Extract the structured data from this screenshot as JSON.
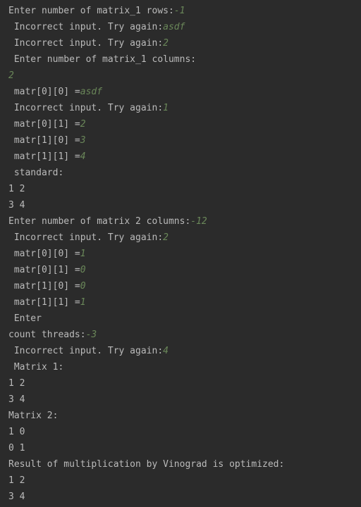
{
  "colors": {
    "background": "#2b2b2b",
    "output_text": "#bbbbbb",
    "user_input": "#6a8759"
  },
  "lines": [
    {
      "prompt": "Enter number of matrix_1 rows:",
      "input": "-1"
    },
    {
      "prompt": " Incorrect input. Try again:",
      "input": "asdf"
    },
    {
      "prompt": " Incorrect input. Try again:",
      "input": "2"
    },
    {
      "prompt": " Enter number of matrix_1 columns:",
      "input": ""
    },
    {
      "prompt": "",
      "input": "2"
    },
    {
      "prompt": " matr[0][0] =",
      "input": "asdf"
    },
    {
      "prompt": " Incorrect input. Try again:",
      "input": "1"
    },
    {
      "prompt": " matr[0][1] =",
      "input": "2"
    },
    {
      "prompt": " matr[1][0] =",
      "input": "3"
    },
    {
      "prompt": " matr[1][1] =",
      "input": "4"
    },
    {
      "prompt": " standard:",
      "input": ""
    },
    {
      "prompt": "1 2",
      "input": ""
    },
    {
      "prompt": "3 4",
      "input": ""
    },
    {
      "prompt": "Enter number of matrix 2 columns:",
      "input": "-12"
    },
    {
      "prompt": " Incorrect input. Try again:",
      "input": "2"
    },
    {
      "prompt": " matr[0][0] =",
      "input": "1"
    },
    {
      "prompt": " matr[0][1] =",
      "input": "0"
    },
    {
      "prompt": " matr[1][0] =",
      "input": "0"
    },
    {
      "prompt": " matr[1][1] =",
      "input": "1"
    },
    {
      "prompt": " Enter",
      "input": ""
    },
    {
      "prompt": "count threads:",
      "input": "-3"
    },
    {
      "prompt": " Incorrect input. Try again:",
      "input": "4"
    },
    {
      "prompt": " Matrix 1:",
      "input": ""
    },
    {
      "prompt": "1 2",
      "input": ""
    },
    {
      "prompt": "3 4",
      "input": ""
    },
    {
      "prompt": "Matrix 2:",
      "input": ""
    },
    {
      "prompt": "1 0",
      "input": ""
    },
    {
      "prompt": "0 1",
      "input": ""
    },
    {
      "prompt": "Result of multiplication by Vinograd is optimized:",
      "input": ""
    },
    {
      "prompt": "1 2",
      "input": ""
    },
    {
      "prompt": "3 4",
      "input": ""
    }
  ]
}
